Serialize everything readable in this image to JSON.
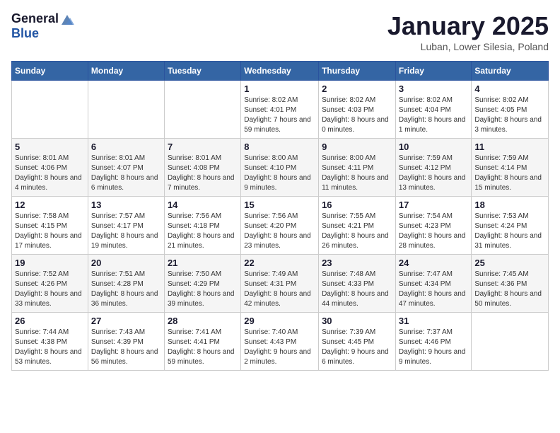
{
  "header": {
    "logo_general": "General",
    "logo_blue": "Blue",
    "month": "January 2025",
    "location": "Luban, Lower Silesia, Poland"
  },
  "weekdays": [
    "Sunday",
    "Monday",
    "Tuesday",
    "Wednesday",
    "Thursday",
    "Friday",
    "Saturday"
  ],
  "weeks": [
    [
      {
        "day": "",
        "sunrise": "",
        "sunset": "",
        "daylight": ""
      },
      {
        "day": "",
        "sunrise": "",
        "sunset": "",
        "daylight": ""
      },
      {
        "day": "",
        "sunrise": "",
        "sunset": "",
        "daylight": ""
      },
      {
        "day": "1",
        "sunrise": "Sunrise: 8:02 AM",
        "sunset": "Sunset: 4:01 PM",
        "daylight": "Daylight: 7 hours and 59 minutes."
      },
      {
        "day": "2",
        "sunrise": "Sunrise: 8:02 AM",
        "sunset": "Sunset: 4:03 PM",
        "daylight": "Daylight: 8 hours and 0 minutes."
      },
      {
        "day": "3",
        "sunrise": "Sunrise: 8:02 AM",
        "sunset": "Sunset: 4:04 PM",
        "daylight": "Daylight: 8 hours and 1 minute."
      },
      {
        "day": "4",
        "sunrise": "Sunrise: 8:02 AM",
        "sunset": "Sunset: 4:05 PM",
        "daylight": "Daylight: 8 hours and 3 minutes."
      }
    ],
    [
      {
        "day": "5",
        "sunrise": "Sunrise: 8:01 AM",
        "sunset": "Sunset: 4:06 PM",
        "daylight": "Daylight: 8 hours and 4 minutes."
      },
      {
        "day": "6",
        "sunrise": "Sunrise: 8:01 AM",
        "sunset": "Sunset: 4:07 PM",
        "daylight": "Daylight: 8 hours and 6 minutes."
      },
      {
        "day": "7",
        "sunrise": "Sunrise: 8:01 AM",
        "sunset": "Sunset: 4:08 PM",
        "daylight": "Daylight: 8 hours and 7 minutes."
      },
      {
        "day": "8",
        "sunrise": "Sunrise: 8:00 AM",
        "sunset": "Sunset: 4:10 PM",
        "daylight": "Daylight: 8 hours and 9 minutes."
      },
      {
        "day": "9",
        "sunrise": "Sunrise: 8:00 AM",
        "sunset": "Sunset: 4:11 PM",
        "daylight": "Daylight: 8 hours and 11 minutes."
      },
      {
        "day": "10",
        "sunrise": "Sunrise: 7:59 AM",
        "sunset": "Sunset: 4:12 PM",
        "daylight": "Daylight: 8 hours and 13 minutes."
      },
      {
        "day": "11",
        "sunrise": "Sunrise: 7:59 AM",
        "sunset": "Sunset: 4:14 PM",
        "daylight": "Daylight: 8 hours and 15 minutes."
      }
    ],
    [
      {
        "day": "12",
        "sunrise": "Sunrise: 7:58 AM",
        "sunset": "Sunset: 4:15 PM",
        "daylight": "Daylight: 8 hours and 17 minutes."
      },
      {
        "day": "13",
        "sunrise": "Sunrise: 7:57 AM",
        "sunset": "Sunset: 4:17 PM",
        "daylight": "Daylight: 8 hours and 19 minutes."
      },
      {
        "day": "14",
        "sunrise": "Sunrise: 7:56 AM",
        "sunset": "Sunset: 4:18 PM",
        "daylight": "Daylight: 8 hours and 21 minutes."
      },
      {
        "day": "15",
        "sunrise": "Sunrise: 7:56 AM",
        "sunset": "Sunset: 4:20 PM",
        "daylight": "Daylight: 8 hours and 23 minutes."
      },
      {
        "day": "16",
        "sunrise": "Sunrise: 7:55 AM",
        "sunset": "Sunset: 4:21 PM",
        "daylight": "Daylight: 8 hours and 26 minutes."
      },
      {
        "day": "17",
        "sunrise": "Sunrise: 7:54 AM",
        "sunset": "Sunset: 4:23 PM",
        "daylight": "Daylight: 8 hours and 28 minutes."
      },
      {
        "day": "18",
        "sunrise": "Sunrise: 7:53 AM",
        "sunset": "Sunset: 4:24 PM",
        "daylight": "Daylight: 8 hours and 31 minutes."
      }
    ],
    [
      {
        "day": "19",
        "sunrise": "Sunrise: 7:52 AM",
        "sunset": "Sunset: 4:26 PM",
        "daylight": "Daylight: 8 hours and 33 minutes."
      },
      {
        "day": "20",
        "sunrise": "Sunrise: 7:51 AM",
        "sunset": "Sunset: 4:28 PM",
        "daylight": "Daylight: 8 hours and 36 minutes."
      },
      {
        "day": "21",
        "sunrise": "Sunrise: 7:50 AM",
        "sunset": "Sunset: 4:29 PM",
        "daylight": "Daylight: 8 hours and 39 minutes."
      },
      {
        "day": "22",
        "sunrise": "Sunrise: 7:49 AM",
        "sunset": "Sunset: 4:31 PM",
        "daylight": "Daylight: 8 hours and 42 minutes."
      },
      {
        "day": "23",
        "sunrise": "Sunrise: 7:48 AM",
        "sunset": "Sunset: 4:33 PM",
        "daylight": "Daylight: 8 hours and 44 minutes."
      },
      {
        "day": "24",
        "sunrise": "Sunrise: 7:47 AM",
        "sunset": "Sunset: 4:34 PM",
        "daylight": "Daylight: 8 hours and 47 minutes."
      },
      {
        "day": "25",
        "sunrise": "Sunrise: 7:45 AM",
        "sunset": "Sunset: 4:36 PM",
        "daylight": "Daylight: 8 hours and 50 minutes."
      }
    ],
    [
      {
        "day": "26",
        "sunrise": "Sunrise: 7:44 AM",
        "sunset": "Sunset: 4:38 PM",
        "daylight": "Daylight: 8 hours and 53 minutes."
      },
      {
        "day": "27",
        "sunrise": "Sunrise: 7:43 AM",
        "sunset": "Sunset: 4:39 PM",
        "daylight": "Daylight: 8 hours and 56 minutes."
      },
      {
        "day": "28",
        "sunrise": "Sunrise: 7:41 AM",
        "sunset": "Sunset: 4:41 PM",
        "daylight": "Daylight: 8 hours and 59 minutes."
      },
      {
        "day": "29",
        "sunrise": "Sunrise: 7:40 AM",
        "sunset": "Sunset: 4:43 PM",
        "daylight": "Daylight: 9 hours and 2 minutes."
      },
      {
        "day": "30",
        "sunrise": "Sunrise: 7:39 AM",
        "sunset": "Sunset: 4:45 PM",
        "daylight": "Daylight: 9 hours and 6 minutes."
      },
      {
        "day": "31",
        "sunrise": "Sunrise: 7:37 AM",
        "sunset": "Sunset: 4:46 PM",
        "daylight": "Daylight: 9 hours and 9 minutes."
      },
      {
        "day": "",
        "sunrise": "",
        "sunset": "",
        "daylight": ""
      }
    ]
  ]
}
